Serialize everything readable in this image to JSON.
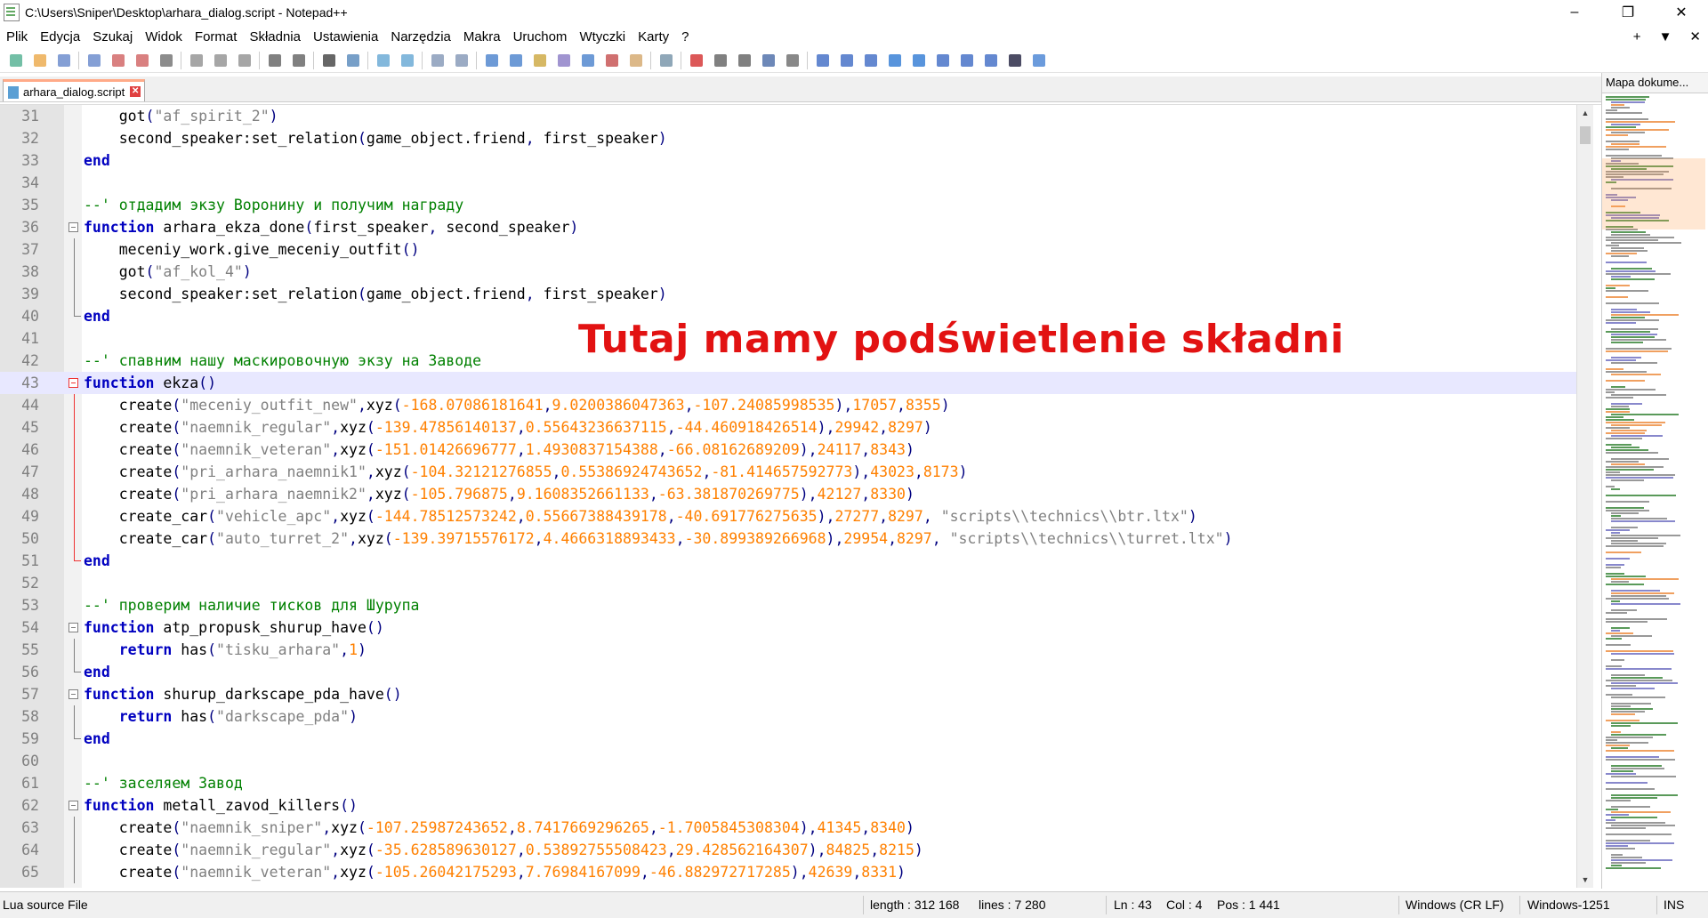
{
  "window": {
    "title": "C:\\Users\\Sniper\\Desktop\\arhara_dialog.script - Notepad++",
    "minimize": "–",
    "restore": "❐",
    "close": "✕"
  },
  "menu": [
    "Plik",
    "Edycja",
    "Szukaj",
    "Widok",
    "Format",
    "Składnia",
    "Ustawienia",
    "Narzędzia",
    "Makra",
    "Uruchom",
    "Wtyczki",
    "Karty",
    "?"
  ],
  "menu_right": {
    "add": "+",
    "dropdown": "▼",
    "close": "✕"
  },
  "toolbar": {
    "icons": [
      "new-file-icon",
      "open-file-icon",
      "save-icon",
      "save-all-icon",
      "close-icon",
      "close-all-icon",
      "print-icon",
      "cut-icon",
      "copy-icon",
      "paste-icon",
      "undo-icon",
      "redo-icon",
      "find-icon",
      "replace-icon",
      "zoom-in-icon",
      "zoom-out-icon",
      "sync-vertical-icon",
      "sync-horizontal-icon",
      "word-wrap-icon",
      "show-all-chars-icon",
      "indent-guide-icon",
      "user-lang-icon",
      "doc-map-icon",
      "function-list-icon",
      "folder-workspace-icon",
      "monitoring-icon",
      "record-macro-icon",
      "stop-record-icon",
      "play-macro-icon",
      "run-macro-multiple-icon",
      "save-macro-icon",
      "plugin-1-icon",
      "plugin-2-icon",
      "plugin-3-icon",
      "plugin-4-icon",
      "plugin-5-icon",
      "plugin-6-icon",
      "plugin-7-icon",
      "plugin-8-icon",
      "plugin-9-icon",
      "plugin-10-icon"
    ]
  },
  "tab": {
    "label": "arhara_dialog.script",
    "close": "✕"
  },
  "overlay": "Tutaj mamy podświetlenie składni",
  "editor": {
    "lines": [
      {
        "n": "31",
        "t": "    got(\"af_spirit_2\")"
      },
      {
        "n": "32",
        "t": "    second_speaker:set_relation(game_object.friend, first_speaker)"
      },
      {
        "n": "33",
        "t": "end"
      },
      {
        "n": "34",
        "t": ""
      },
      {
        "n": "35",
        "t": "--' отдадим экзу Воронину и получим награду"
      },
      {
        "n": "36",
        "t": "function arhara_ekza_done(first_speaker, second_speaker)"
      },
      {
        "n": "37",
        "t": "    meceniy_work.give_meceniy_outfit()"
      },
      {
        "n": "38",
        "t": "    got(\"af_kol_4\")"
      },
      {
        "n": "39",
        "t": "    second_speaker:set_relation(game_object.friend, first_speaker)"
      },
      {
        "n": "40",
        "t": "end"
      },
      {
        "n": "41",
        "t": ""
      },
      {
        "n": "42",
        "t": "--' спавним нашу маскировочную экзу на Заводе"
      },
      {
        "n": "43",
        "t": "function ekza()"
      },
      {
        "n": "44",
        "t": "    create(\"meceniy_outfit_new\",xyz(-168.07086181641,9.0200386047363,-107.24085998535),17057,8355)"
      },
      {
        "n": "45",
        "t": "    create(\"naemnik_regular\",xyz(-139.47856140137,0.55643236637115,-44.460918426514),29942,8297)"
      },
      {
        "n": "46",
        "t": "    create(\"naemnik_veteran\",xyz(-151.01426696777,1.4930837154388,-66.08162689209),24117,8343)"
      },
      {
        "n": "47",
        "t": "    create(\"pri_arhara_naemnik1\",xyz(-104.32121276855,0.55386924743652,-81.414657592773),43023,8173)"
      },
      {
        "n": "48",
        "t": "    create(\"pri_arhara_naemnik2\",xyz(-105.796875,9.1608352661133,-63.381870269775),42127,8330)"
      },
      {
        "n": "49",
        "t": "    create_car(\"vehicle_apc\",xyz(-144.78512573242,0.55667388439178,-40.691776275635),27277,8297, \"scripts\\\\technics\\\\btr.ltx\")"
      },
      {
        "n": "50",
        "t": "    create_car(\"auto_turret_2\",xyz(-139.39715576172,4.4666318893433,-30.899389266968),29954,8297, \"scripts\\\\technics\\\\turret.ltx\")"
      },
      {
        "n": "51",
        "t": "end"
      },
      {
        "n": "52",
        "t": ""
      },
      {
        "n": "53",
        "t": "--' проверим наличие тисков для Шурупа"
      },
      {
        "n": "54",
        "t": "function atp_propusk_shurup_have()"
      },
      {
        "n": "55",
        "t": "    return has(\"tisku_arhara\",1)"
      },
      {
        "n": "56",
        "t": "end"
      },
      {
        "n": "57",
        "t": "function shurup_darkscape_pda_have()"
      },
      {
        "n": "58",
        "t": "    return has(\"darkscape_pda\")"
      },
      {
        "n": "59",
        "t": "end"
      },
      {
        "n": "60",
        "t": ""
      },
      {
        "n": "61",
        "t": "--' заселяем Завод"
      },
      {
        "n": "62",
        "t": "function metall_zavod_killers()"
      },
      {
        "n": "63",
        "t": "    create(\"naemnik_sniper\",xyz(-107.25987243652,8.7417669296265,-1.7005845308304),41345,8340)"
      },
      {
        "n": "64",
        "t": "    create(\"naemnik_regular\",xyz(-35.628589630127,0.53892755508423,29.428562164307),84825,8215)"
      },
      {
        "n": "65",
        "t": "    create(\"naemnik_veteran\",xyz(-105.26042175293,7.76984167099,-46.882972717285),42639,8331)"
      }
    ]
  },
  "docmap": {
    "title": "Mapa dokume..."
  },
  "status": {
    "file_type": "Lua source File",
    "length": "length : 312 168",
    "lines": "lines : 7 280",
    "ln": "Ln : 43",
    "col": "Col : 4",
    "pos": "Pos : 1 441",
    "eol": "Windows (CR LF)",
    "encoding": "Windows-1251",
    "mode": "INS"
  },
  "colors": {
    "keyword": "#0000c0",
    "string": "#808080",
    "number": "#ff8000",
    "comment": "#008000",
    "overlay": "#e21212",
    "current_line": "#e8e8ff"
  }
}
